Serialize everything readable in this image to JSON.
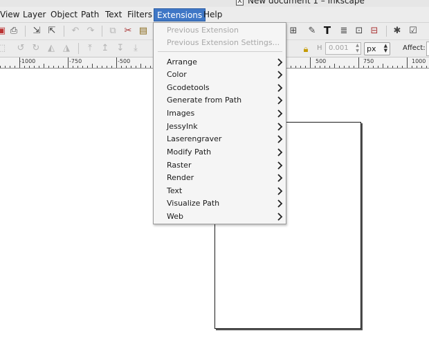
{
  "window": {
    "title": "New document 1 – Inkscape",
    "close_glyph": "X"
  },
  "menubar": {
    "items": [
      {
        "label": "View"
      },
      {
        "label": "Layer"
      },
      {
        "label": "Object"
      },
      {
        "label": "Path"
      },
      {
        "label": "Text"
      },
      {
        "label": "Filters"
      },
      {
        "label": "Extensions"
      },
      {
        "label": "Help"
      }
    ],
    "active": "Extensions"
  },
  "toolbar": {
    "h_label": "H",
    "h_value": "0.001",
    "unit": "px",
    "affect_label": "Affect:"
  },
  "ruler": {
    "labels": [
      "-1000",
      "-750",
      "-500",
      "500",
      "750",
      "1000"
    ]
  },
  "extensions_menu": {
    "previous_extension": "Previous Extension",
    "previous_extension_settings": "Previous Extension Settings...",
    "items": [
      {
        "label": "Arrange"
      },
      {
        "label": "Color"
      },
      {
        "label": "Gcodetools"
      },
      {
        "label": "Generate from Path"
      },
      {
        "label": "Images"
      },
      {
        "label": "JessyInk"
      },
      {
        "label": "Laserengraver"
      },
      {
        "label": "Modify Path"
      },
      {
        "label": "Raster"
      },
      {
        "label": "Render"
      },
      {
        "label": "Text"
      },
      {
        "label": "Visualize Path"
      },
      {
        "label": "Web"
      }
    ]
  },
  "colors": {
    "menu_highlight": "#3f77c6",
    "menu_background": "#f5f5f5",
    "toolbar_background": "#ececec"
  }
}
